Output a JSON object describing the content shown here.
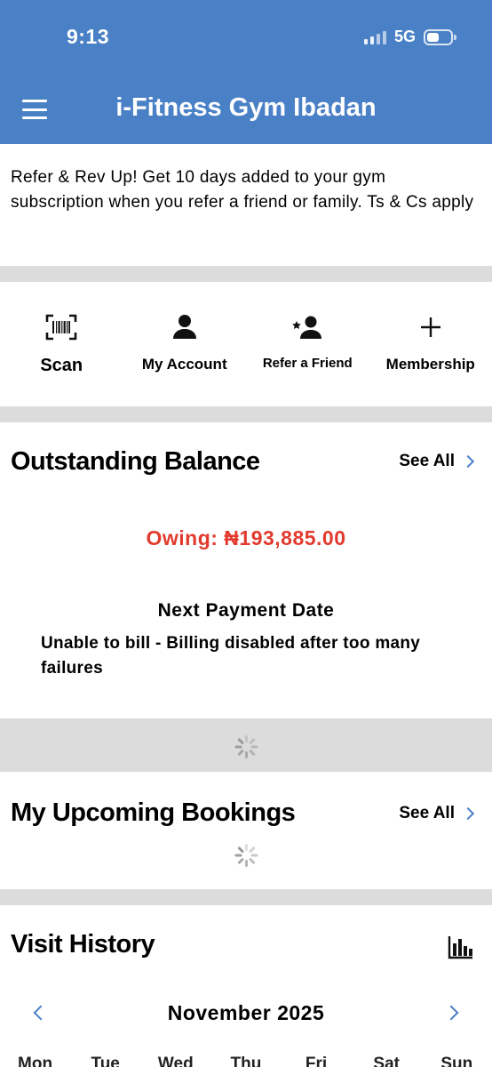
{
  "status_bar": {
    "time": "9:13",
    "network": "5G"
  },
  "app": {
    "title": "i-Fitness Gym Ibadan"
  },
  "promo": {
    "text": "Refer & Rev Up! Get 10 days added to your gym subscription when you refer a friend or family. Ts & Cs apply"
  },
  "quick_actions": [
    {
      "label": "Scan",
      "icon": "barcode-scan-icon"
    },
    {
      "label": "My Account",
      "icon": "person-icon"
    },
    {
      "label": "Refer a Friend",
      "icon": "person-star-icon"
    },
    {
      "label": "Membership",
      "icon": "plus-icon"
    }
  ],
  "balance": {
    "title": "Outstanding Balance",
    "see_all": "See All",
    "owing": "Owing: ₦193,885.00",
    "next_payment_title": "Next Payment Date",
    "next_payment_value": "Unable to bill - Billing disabled after too many failures"
  },
  "bookings": {
    "title": "My Upcoming Bookings",
    "see_all": "See All"
  },
  "visits": {
    "title": "Visit History",
    "month": "November 2025",
    "weekdays": [
      "Mon",
      "Tue",
      "Wed",
      "Thu",
      "Fri",
      "Sat",
      "Sun"
    ]
  },
  "colors": {
    "brand": "#4a80c6",
    "owing": "#e23b2e"
  }
}
